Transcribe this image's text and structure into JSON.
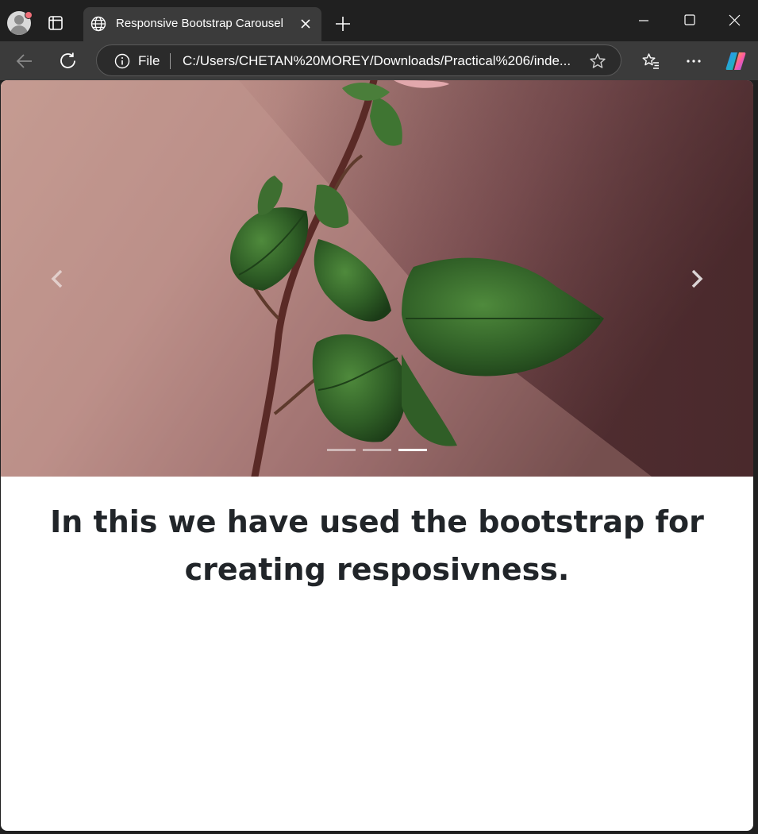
{
  "browser": {
    "tab": {
      "title": "Responsive Bootstrap Carousel"
    },
    "address_bar": {
      "scheme_label": "File",
      "url": "C:/Users/CHETAN%20MOREY/Downloads/Practical%206/inde..."
    },
    "icons": {
      "profile": "profile-avatar-icon",
      "tab_actions": "tab-actions-icon",
      "favicon": "globe-icon",
      "close_tab": "close-icon",
      "new_tab": "plus-icon",
      "minimize": "minimize-icon",
      "maximize": "maximize-icon",
      "close_window": "close-icon",
      "back": "arrow-left-icon",
      "reload": "reload-icon",
      "site_info": "info-icon",
      "favorite": "star-icon",
      "favorites": "favorites-icon",
      "more": "more-icon",
      "copilot": "copilot-icon"
    },
    "colors": {
      "frame": "#202020",
      "toolbar": "#3b3b3b",
      "profile_badge": "#f1707a"
    }
  },
  "page": {
    "carousel": {
      "slide_count": 3,
      "active_slide": 3,
      "image_subject": "rose stem with green leaves against a pink wall"
    },
    "headline": "In this we have used the bootstrap for creating resposivness.",
    "colors": {
      "headline": "#212529",
      "background": "#ffffff"
    }
  }
}
